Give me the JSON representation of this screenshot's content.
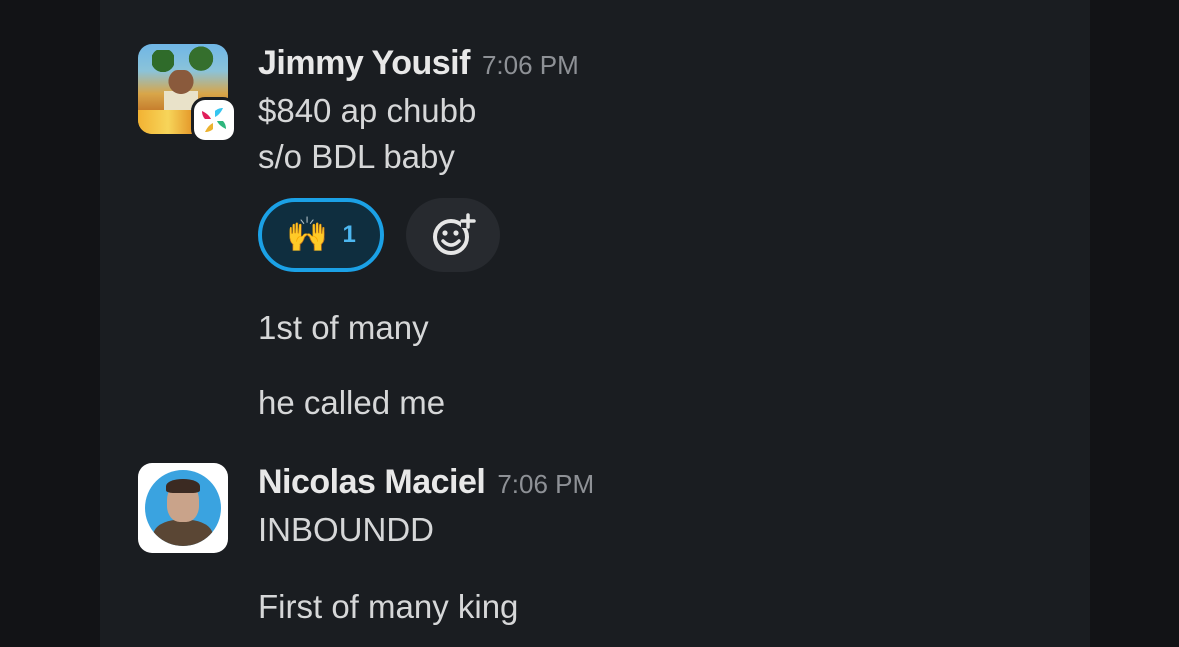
{
  "messages": [
    {
      "author": "Jimmy Yousif",
      "time": "7:06 PM",
      "lines": [
        "$840 ap chubb",
        "s/o BDL baby"
      ],
      "avatar_icon": "user-avatar-photo",
      "badge_icon": "app-badge-icon",
      "reactions": [
        {
          "emoji": "🙌",
          "emoji_name": "raised-hands-icon",
          "count": "1",
          "selected": true
        }
      ],
      "add_reaction_icon": "add-reaction-icon"
    },
    {
      "author": "",
      "lines": [
        "1st of many"
      ]
    },
    {
      "author": "",
      "lines": [
        "he called me"
      ]
    },
    {
      "author": "Nicolas Maciel",
      "time": "7:06 PM",
      "lines": [
        "INBOUNDD"
      ],
      "avatar_icon": "user-avatar-photo"
    },
    {
      "author": "",
      "lines": [
        "First of many king"
      ]
    }
  ],
  "colors": {
    "background": "#1a1d21",
    "outer_background": "#121316",
    "reaction_border": "#1ba1e6",
    "reaction_count": "#4db7f0",
    "timestamp": "#8e9196"
  }
}
